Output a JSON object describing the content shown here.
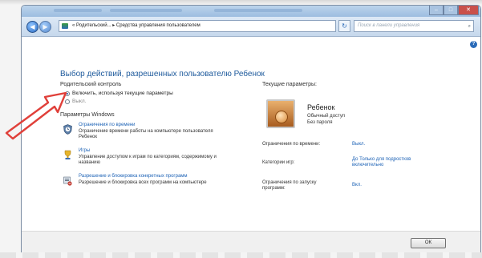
{
  "window": {
    "address_path": "« Родительский... ▸ Средства управления пользователем",
    "search_placeholder": "Поиск в панели управления"
  },
  "page": {
    "heading": "Выбор действий, разрешенных пользователю Ребенок"
  },
  "parental_control": {
    "title": "Родительский контроль",
    "options": [
      {
        "label": "Включить, используя текущие параметры",
        "selected": true
      },
      {
        "label": "Выкл.",
        "selected": false
      }
    ]
  },
  "windows_settings": {
    "title": "Параметры Windows",
    "items": [
      {
        "icon": "clock-shield-icon",
        "link": "Ограничения по времени",
        "description": "Ограничение времени работы на компьютере пользователя Ребенок"
      },
      {
        "icon": "trophy-icon",
        "link": "Игры",
        "description": "Управление доступом к играм по категориям, содержимому и названию"
      },
      {
        "icon": "program-block-icon",
        "link": "Разрешение и блокировка конкретных программ",
        "description": "Разрешение и блокировка всех программ на компьютере"
      }
    ]
  },
  "current_settings": {
    "title": "Текущие параметры:",
    "user_name": "Ребенок",
    "user_role": "Обычный доступ",
    "user_password": "Без пароля",
    "rows": [
      {
        "label": "Ограничения по времени:",
        "value": "Выкл."
      },
      {
        "label": "Категории игр:",
        "value": "До Только для подростков включительно"
      },
      {
        "label": "Ограничения по запуску программ:",
        "value": "Вкл."
      }
    ]
  },
  "footer": {
    "ok_label": "ОК"
  },
  "colors": {
    "accent": "#1e5a9c",
    "link": "#1e63b6",
    "arrow": "#e0403a"
  }
}
